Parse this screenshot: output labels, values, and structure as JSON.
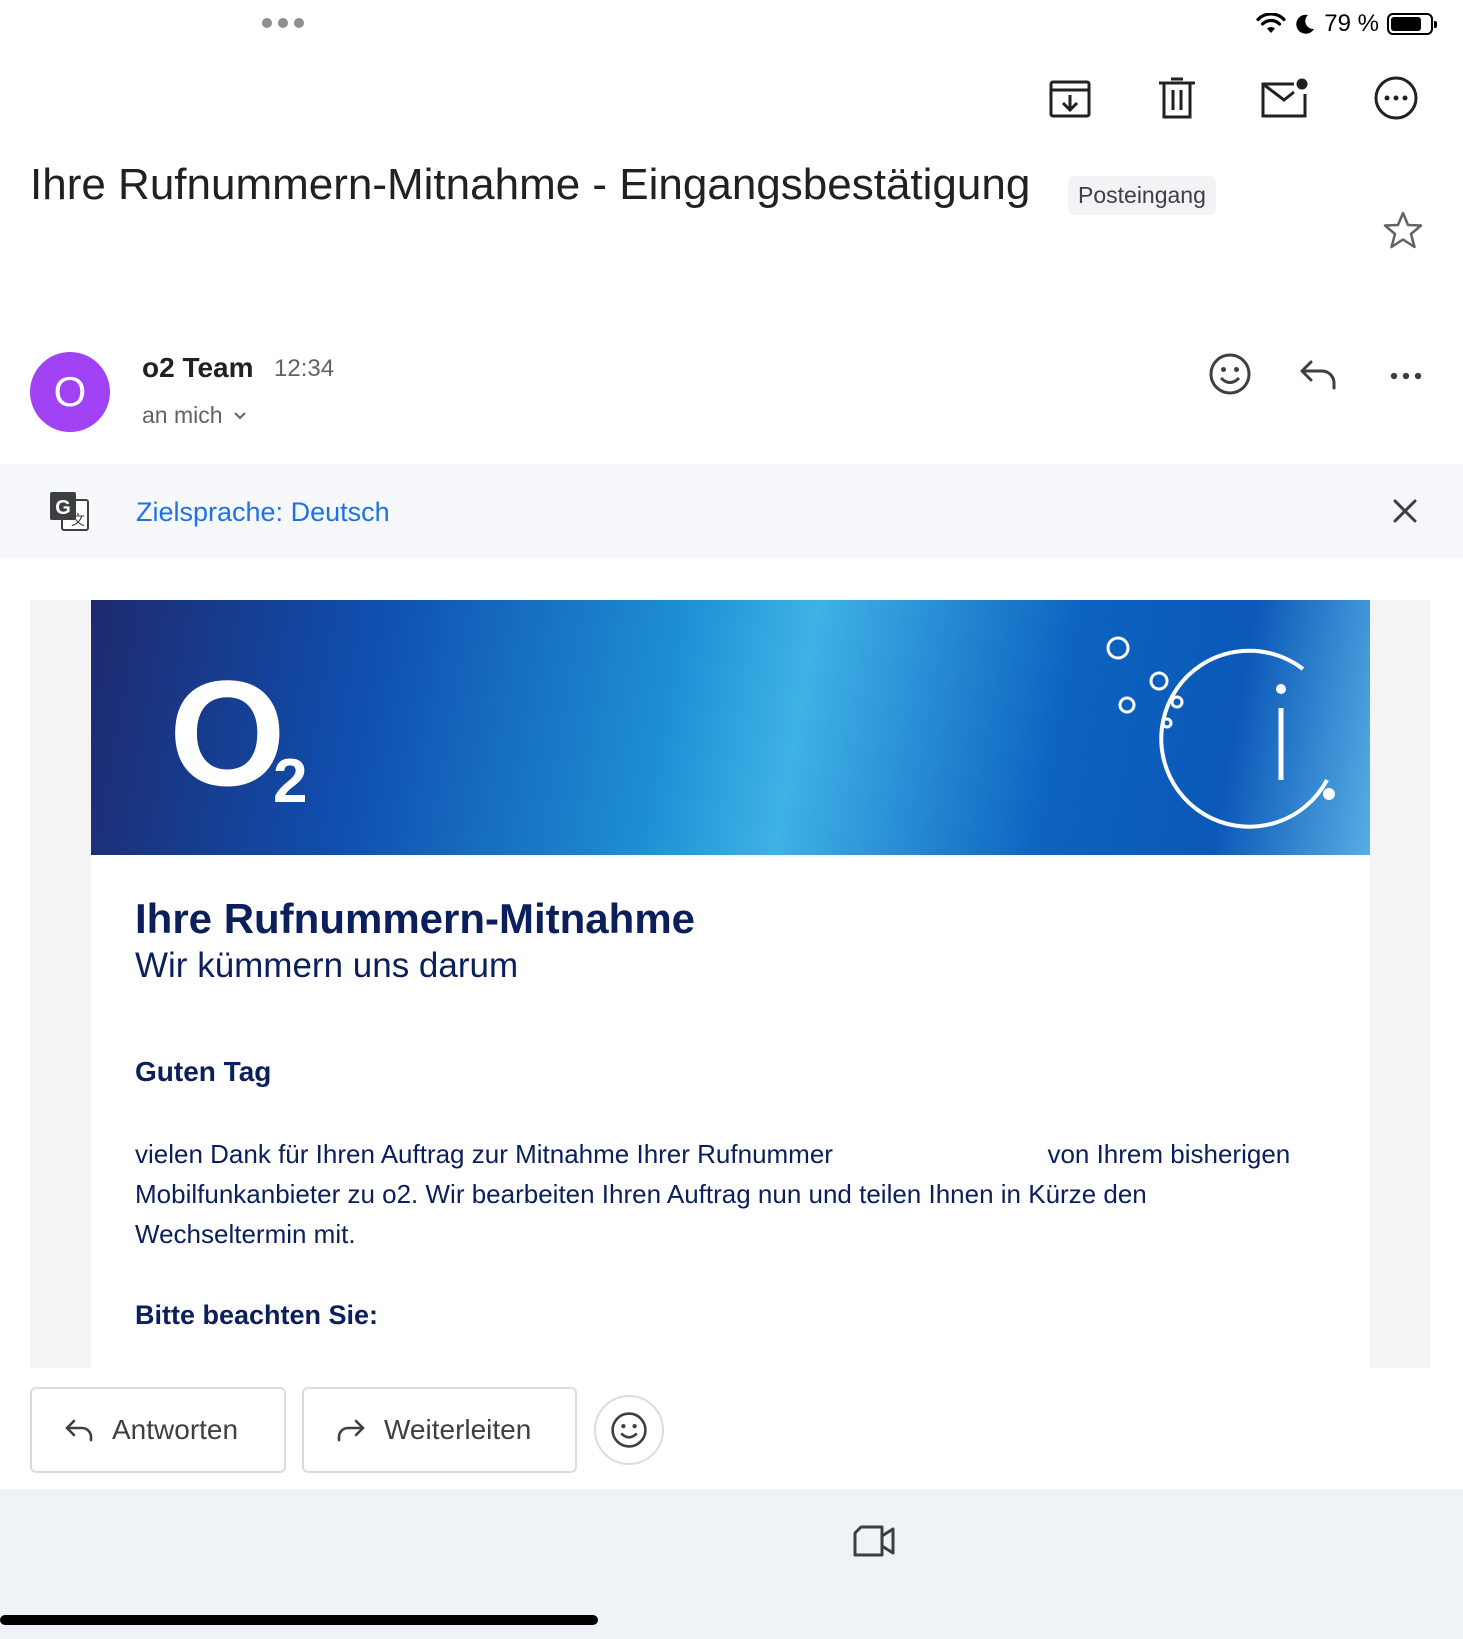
{
  "status_bar": {
    "battery": "79 %",
    "battery_level": 0.79
  },
  "toolbar": {
    "archive_icon": "archive-icon",
    "delete_icon": "trash-icon",
    "mark_unread_icon": "mail-unread-icon",
    "more_icon": "more-circle-icon"
  },
  "email": {
    "subject": "Ihre Rufnummern-Mitnahme - Eingangsbestätigung",
    "label": "Posteingang",
    "sender": {
      "initial": "O",
      "name": "o2 Team",
      "time": "12:34",
      "recipient": "an mich",
      "avatar_color": "#a142f4"
    }
  },
  "translate": {
    "text": "Zielsprache: Deutsch"
  },
  "content": {
    "heading": "Ihre Rufnummern-Mitnahme",
    "subheading": "Wir kümmern uns darum",
    "greeting": "Guten Tag",
    "paragraph_part1": "vielen Dank für Ihren Auftrag zur Mitnahme Ihrer Rufnummer",
    "paragraph_part2": "von Ihrem bisherigen Mobilfunkanbieter zu o2. Wir bearbeiten Ihren Auftrag nun und teilen Ihnen in Kürze den Wechseltermin mit.",
    "note_heading": "Bitte beachten Sie:",
    "brand_colors": {
      "text": "#0a1f5c",
      "banner_blue": "#0f4fb0"
    }
  },
  "actions": {
    "reply": "Antworten",
    "forward": "Weiterleiten"
  },
  "accent_color": "#1a73e8"
}
